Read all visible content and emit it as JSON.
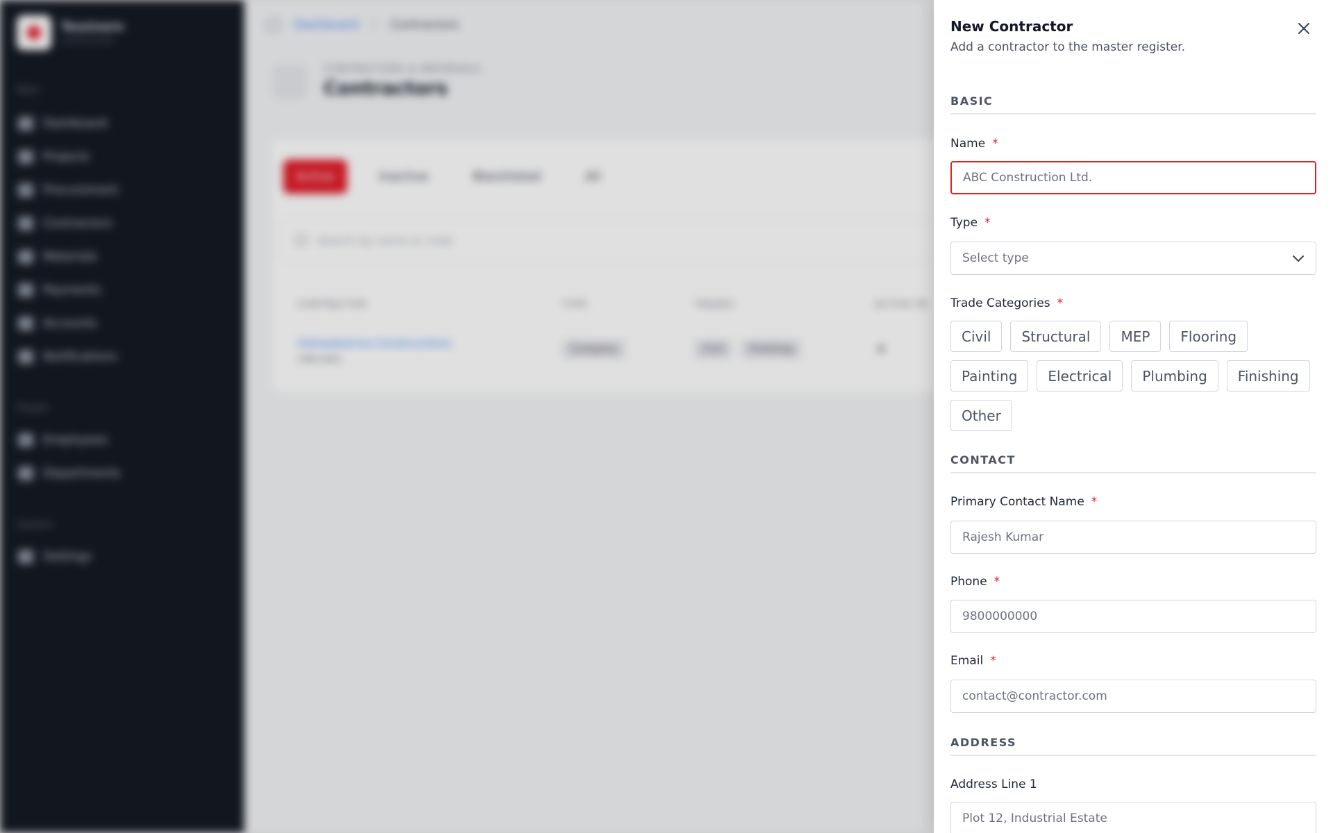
{
  "sidebar": {
    "brand": {
      "name": "Tessivern",
      "subtitle": "Construction"
    },
    "groups": [
      {
        "label": "Main",
        "items": [
          "Dashboard",
          "Projects",
          "Procurement",
          "Contractors",
          "Materials",
          "Payments",
          "Accounts",
          "Notifications"
        ]
      },
      {
        "label": "People",
        "items": [
          "Employees",
          "Departments"
        ]
      },
      {
        "label": "System",
        "items": [
          "Settings"
        ]
      }
    ]
  },
  "breadcrumb": {
    "parent": "Dashboard",
    "separator": "/",
    "current": "Contractors"
  },
  "page": {
    "kicker": "CONTRACTORS & MATERIALS",
    "title": "Contractors"
  },
  "tabs": [
    "Active",
    "Inactive",
    "Blacklisted",
    "All"
  ],
  "search_placeholder": "Search by name or code",
  "table": {
    "headers": [
      "CONTRACTOR",
      "TYPE",
      "TRADES",
      "ACTIVE PR"
    ],
    "rows": [
      {
        "name": "Vishwakarma Constructions",
        "code": "CNR-0001",
        "type": "Company",
        "trades": [
          "Civil",
          "Finishing"
        ],
        "active": "0"
      }
    ]
  },
  "drawer": {
    "title": "New Contractor",
    "subtitle": "Add a contractor to the master register.",
    "sections": {
      "basic": "BASIC",
      "contact": "CONTACT",
      "address": "ADDRESS"
    },
    "fields": {
      "name": {
        "label": "Name",
        "placeholder": "ABC Construction Ltd."
      },
      "type": {
        "label": "Type",
        "placeholder": "Select type"
      },
      "trade_categories": {
        "label": "Trade Categories",
        "options": [
          "Civil",
          "Structural",
          "MEP",
          "Flooring",
          "Painting",
          "Electrical",
          "Plumbing",
          "Finishing",
          "Other"
        ]
      },
      "primary_contact": {
        "label": "Primary Contact Name",
        "placeholder": "Rajesh Kumar"
      },
      "phone": {
        "label": "Phone",
        "placeholder": "9800000000"
      },
      "email": {
        "label": "Email",
        "placeholder": "contact@contractor.com"
      },
      "address_line1": {
        "label": "Address Line 1",
        "placeholder": "Plot 12, Industrial Estate"
      }
    },
    "required_mark": "*"
  },
  "colors": {
    "accent": "#e11d2a",
    "error": "#dc2626",
    "sidebar": "#151a24",
    "link": "#3b82f6"
  }
}
